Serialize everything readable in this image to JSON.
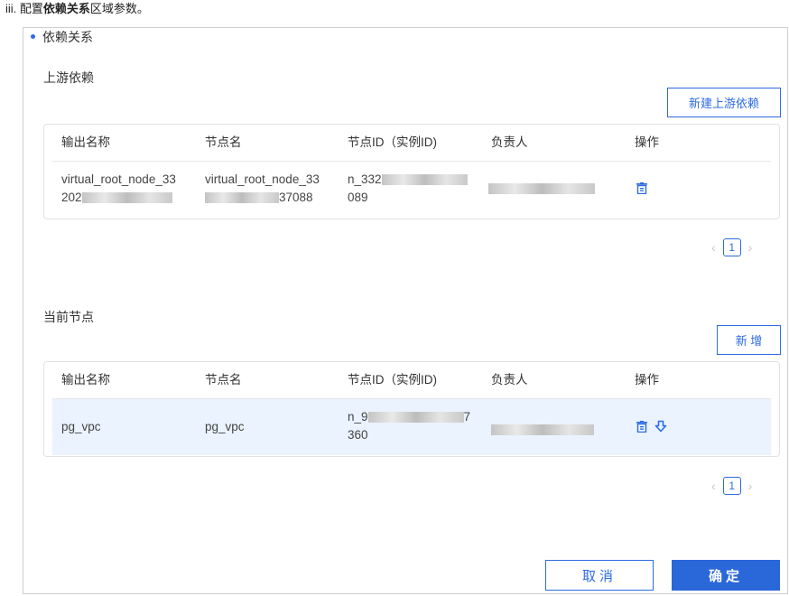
{
  "doc_line": {
    "prefix": "iii. 配置",
    "bold": "依赖关系",
    "suffix": "区域参数。"
  },
  "section": {
    "title": "依赖关系"
  },
  "upstream": {
    "title": "上游依赖",
    "new_button": "新建上游依赖",
    "headers": [
      "输出名称",
      "节点名",
      "节点ID（实例ID)",
      "负责人",
      "操作"
    ],
    "row": {
      "output_name_line1": "virtual_root_node_33",
      "output_name_line2_start": "202",
      "node_name_line1": "virtual_root_node_33",
      "node_name_line2_end": "37088",
      "node_id_line1_start": "n_332",
      "node_id_line2": "089"
    },
    "pager": {
      "page": "1"
    }
  },
  "current": {
    "title": "当前节点",
    "add_button": "新 增",
    "headers": [
      "输出名称",
      "节点名",
      "节点ID（实例ID)",
      "负责人",
      "操作"
    ],
    "row": {
      "output_name": "pg_vpc",
      "node_name": "pg_vpc",
      "node_id_line1_start": "n_9",
      "node_id_line1_end": "7",
      "node_id_line2": "360"
    },
    "pager": {
      "page": "1"
    }
  },
  "footer": {
    "cancel": "取消",
    "confirm": "确定"
  },
  "colors": {
    "accent": "#2d6be0",
    "selected_row": "#eaf3ff",
    "primary_button": "#2a67d8"
  },
  "icons": {
    "delete": "trash-icon",
    "move": "arrow-down-icon",
    "prev": "chevron-left-icon",
    "next": "chevron-right-icon"
  }
}
